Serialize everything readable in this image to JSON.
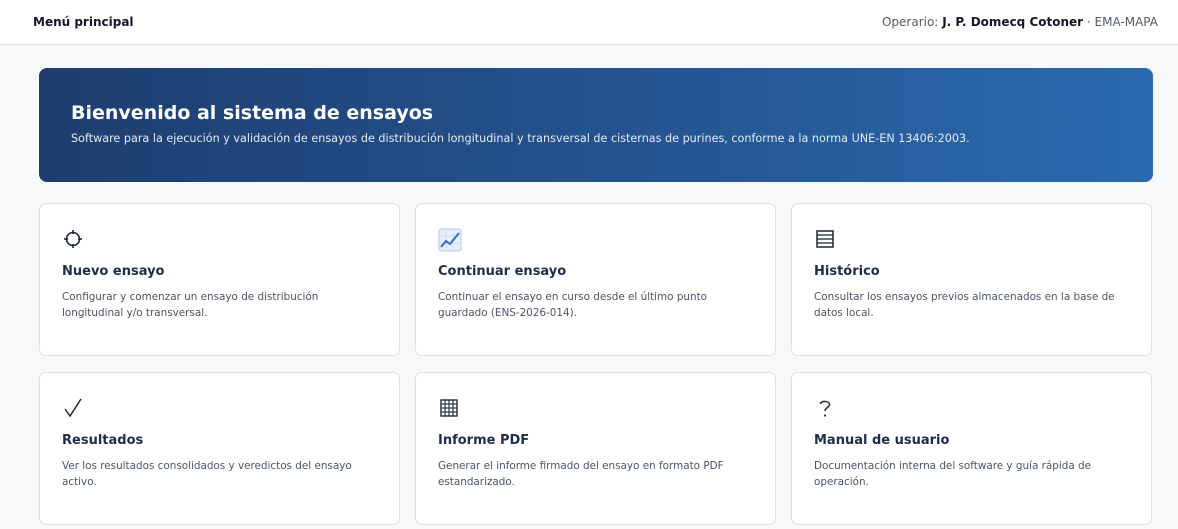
{
  "header": {
    "title": "Menú principal",
    "operator_label": "Operario:",
    "operator_name": "J. P. Domecq Cotoner",
    "org": "· EMA-MAPA"
  },
  "hero": {
    "title": "Bienvenido al sistema de ensayos",
    "subtitle": "Software para la ejecución y validación de ensayos de distribución longitudinal y transversal de cisternas de purines, conforme a la norma UNE-EN 13406:2003."
  },
  "cards": [
    {
      "icon": "crosshair-icon",
      "title": "Nuevo ensayo",
      "desc": "Configurar y comenzar un ensayo de distribución longitudinal y/o transversal."
    },
    {
      "icon": "chart-increasing-icon",
      "title": "Continuar ensayo",
      "desc": "Continuar el ensayo en curso desde el último punto guardado (ENS-2026-014)."
    },
    {
      "icon": "list-icon",
      "title": "Histórico",
      "desc": "Consultar los ensayos previos almacenados en la base de datos local."
    },
    {
      "icon": "checkmark-icon",
      "title": "Resultados",
      "desc": "Ver los resultados consolidados y veredictos del ensayo activo."
    },
    {
      "icon": "grid-icon",
      "title": "Informe PDF",
      "desc": "Generar el informe firmado del ensayo en formato PDF estandarizado."
    },
    {
      "icon": "question-icon",
      "title": "Manual de usuario",
      "desc": "Documentación interna del software y guía rápida de operación."
    }
  ]
}
